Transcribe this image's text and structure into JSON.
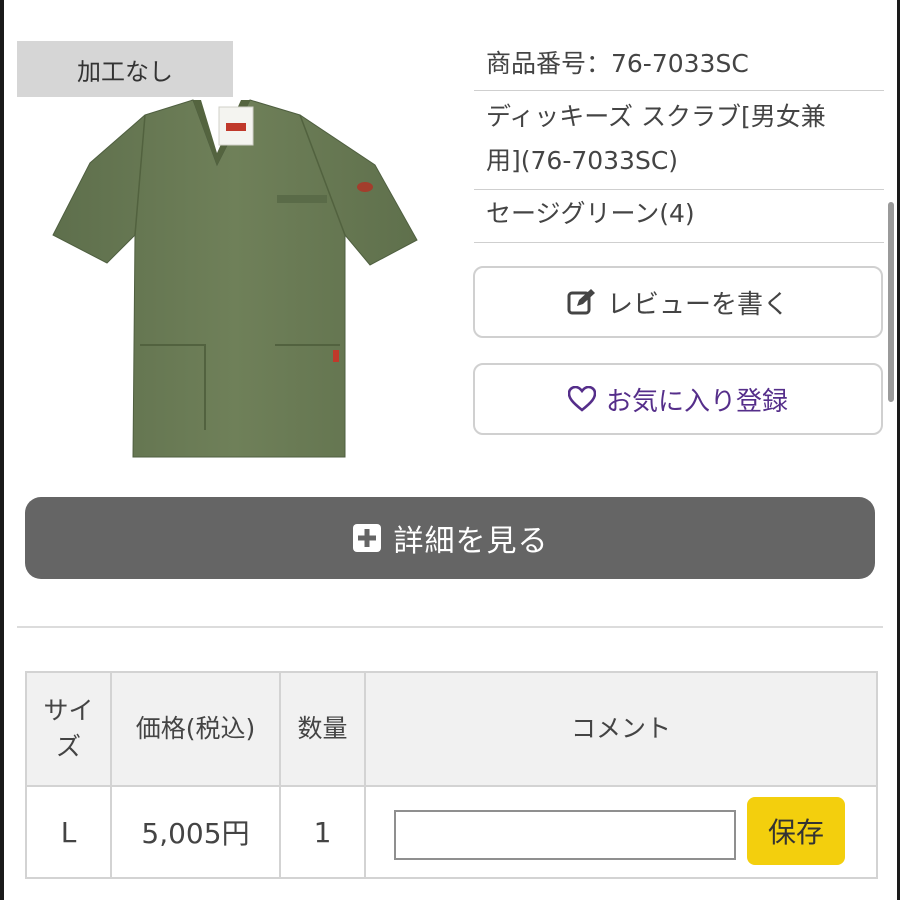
{
  "badge": "加工なし",
  "product": {
    "number_label": "商品番号：76-7033SC",
    "name_line1": "ディッキーズ スクラブ[男女兼",
    "name_line2": "用](76-7033SC)",
    "color": "セージグリーン(4)"
  },
  "buttons": {
    "review": "レビューを書く",
    "favorite": "お気に入り登録",
    "detail": "詳細を見る",
    "save": "保存"
  },
  "icons": {
    "review": "edit-icon",
    "favorite": "heart-icon",
    "detail": "plus-square-icon"
  },
  "table": {
    "headers": {
      "size_line1": "サイ",
      "size_line2": "ズ",
      "price": "価格(税込)",
      "quantity": "数量",
      "comment": "コメント"
    },
    "row": {
      "size": "L",
      "price": "5,005円",
      "quantity": "1",
      "comment": ""
    }
  },
  "colors": {
    "garment": "#6b7c57",
    "detail_button": "#656565",
    "save_button": "#f3cf0d",
    "favorite_text": "#552e8a"
  }
}
